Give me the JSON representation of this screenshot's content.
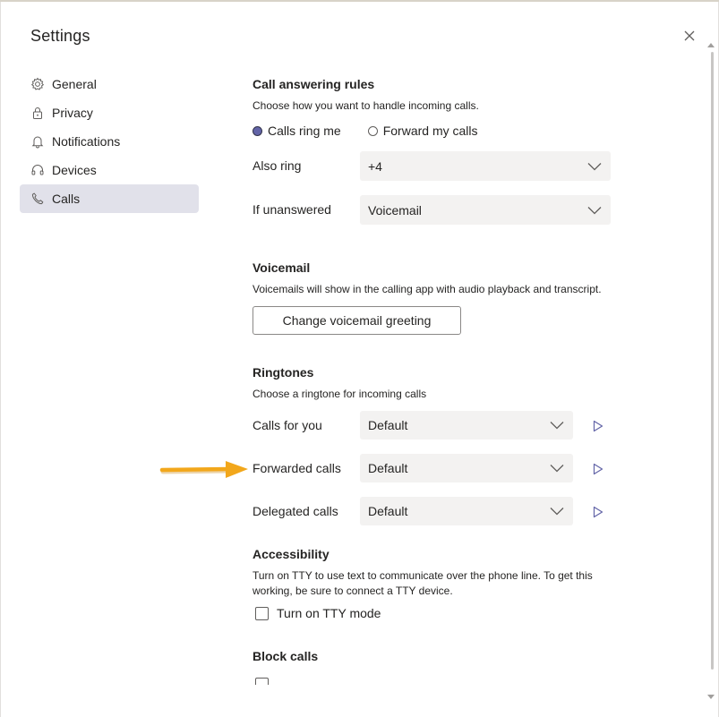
{
  "dialog": {
    "title": "Settings",
    "close_icon": "close-icon"
  },
  "sidebar": {
    "items": [
      {
        "label": "General",
        "icon": "gear-icon",
        "active": false
      },
      {
        "label": "Privacy",
        "icon": "lock-icon",
        "active": false
      },
      {
        "label": "Notifications",
        "icon": "bell-icon",
        "active": false
      },
      {
        "label": "Devices",
        "icon": "headset-icon",
        "active": false
      },
      {
        "label": "Calls",
        "icon": "phone-icon",
        "active": true
      }
    ]
  },
  "call_answering": {
    "heading": "Call answering rules",
    "description": "Choose how you want to handle incoming calls.",
    "option_ring": "Calls ring me",
    "option_forward": "Forward my calls",
    "selected_option": "Calls ring me",
    "also_ring_label": "Also ring",
    "also_ring_value": "+4",
    "if_unanswered_label": "If unanswered",
    "if_unanswered_value": "Voicemail"
  },
  "voicemail": {
    "heading": "Voicemail",
    "description": "Voicemails will show in the calling app with audio playback and transcript.",
    "button_label": "Change voicemail greeting"
  },
  "ringtones": {
    "heading": "Ringtones",
    "description": "Choose a ringtone for incoming calls",
    "rows": [
      {
        "label": "Calls for you",
        "value": "Default"
      },
      {
        "label": "Forwarded calls",
        "value": "Default"
      },
      {
        "label": "Delegated calls",
        "value": "Default"
      }
    ]
  },
  "accessibility": {
    "heading": "Accessibility",
    "description": "Turn on TTY to use text to communicate over the phone line. To get this working, be sure to connect a TTY device.",
    "tty_label": "Turn on TTY mode",
    "tty_checked": false
  },
  "block_calls": {
    "heading": "Block calls"
  },
  "colors": {
    "accent": "#6264a7",
    "annotation_arrow": "#f2a71b",
    "active_nav_bg": "#e1e1ea",
    "select_bg": "#f3f2f1"
  }
}
